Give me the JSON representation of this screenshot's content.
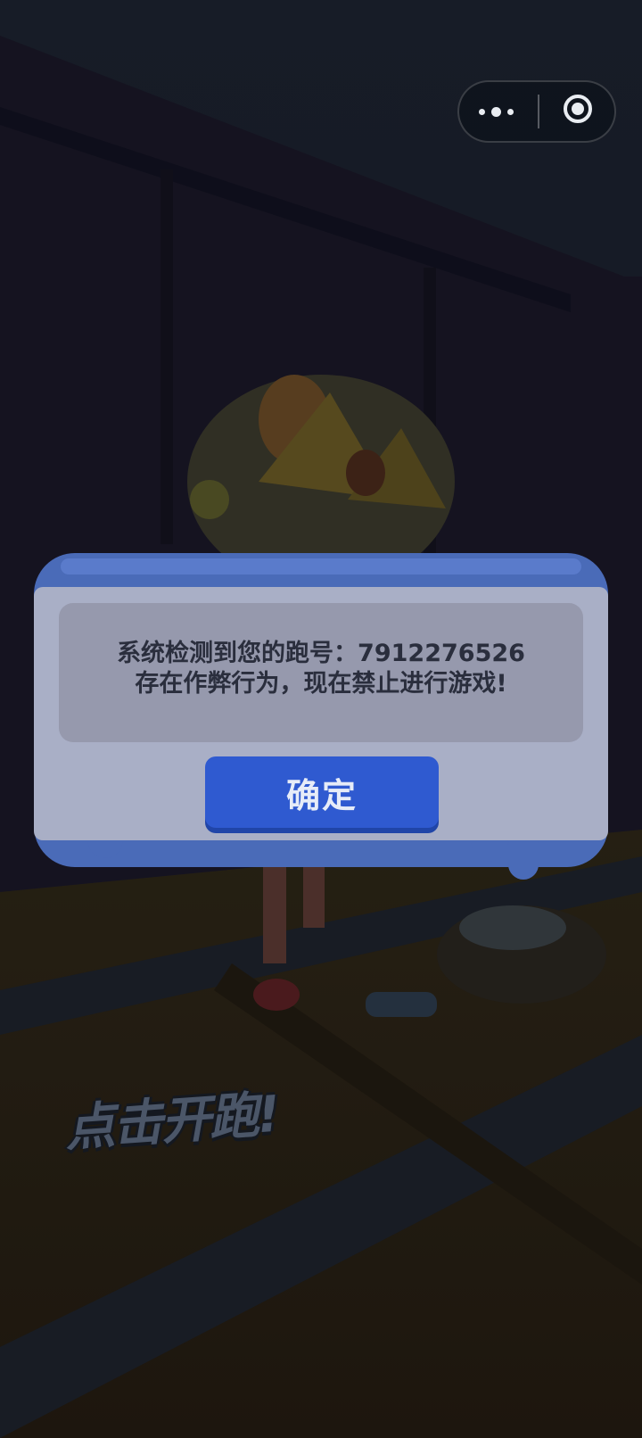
{
  "capsule": {
    "more_icon": "more-dots-icon",
    "close_icon": "close-target-icon"
  },
  "dialog": {
    "message_line1": "系统检测到您的跑号：7912276526",
    "message_line2": "存在作弊行为，现在禁止进行游戏!",
    "confirm_label": "确定"
  },
  "game": {
    "start_run_label": "点击开跑!"
  },
  "colors": {
    "dialog_frame": "#4a6bb8",
    "dialog_body": "#a9afc6",
    "confirm_button": "#2f5ad0"
  }
}
